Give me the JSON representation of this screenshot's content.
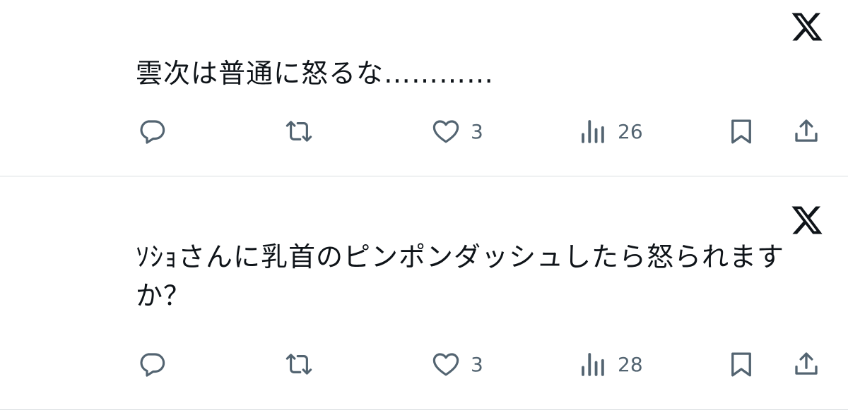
{
  "tweets": [
    {
      "text": "雲次は普通に怒るな…………",
      "likes": "3",
      "views": "26"
    },
    {
      "text": "ｿｼｮさんに乳首のピンポンダッシュしたら怒られますか？",
      "likes": "3",
      "views": "28"
    }
  ],
  "icons": {
    "more": "x-logo-icon",
    "reply": "reply-icon",
    "retweet": "retweet-icon",
    "like": "heart-icon",
    "views": "views-icon",
    "bookmark": "bookmark-icon",
    "share": "share-icon"
  },
  "colors": {
    "text": "#0f1419",
    "icon": "#536471",
    "divider": "#d9dde0"
  }
}
